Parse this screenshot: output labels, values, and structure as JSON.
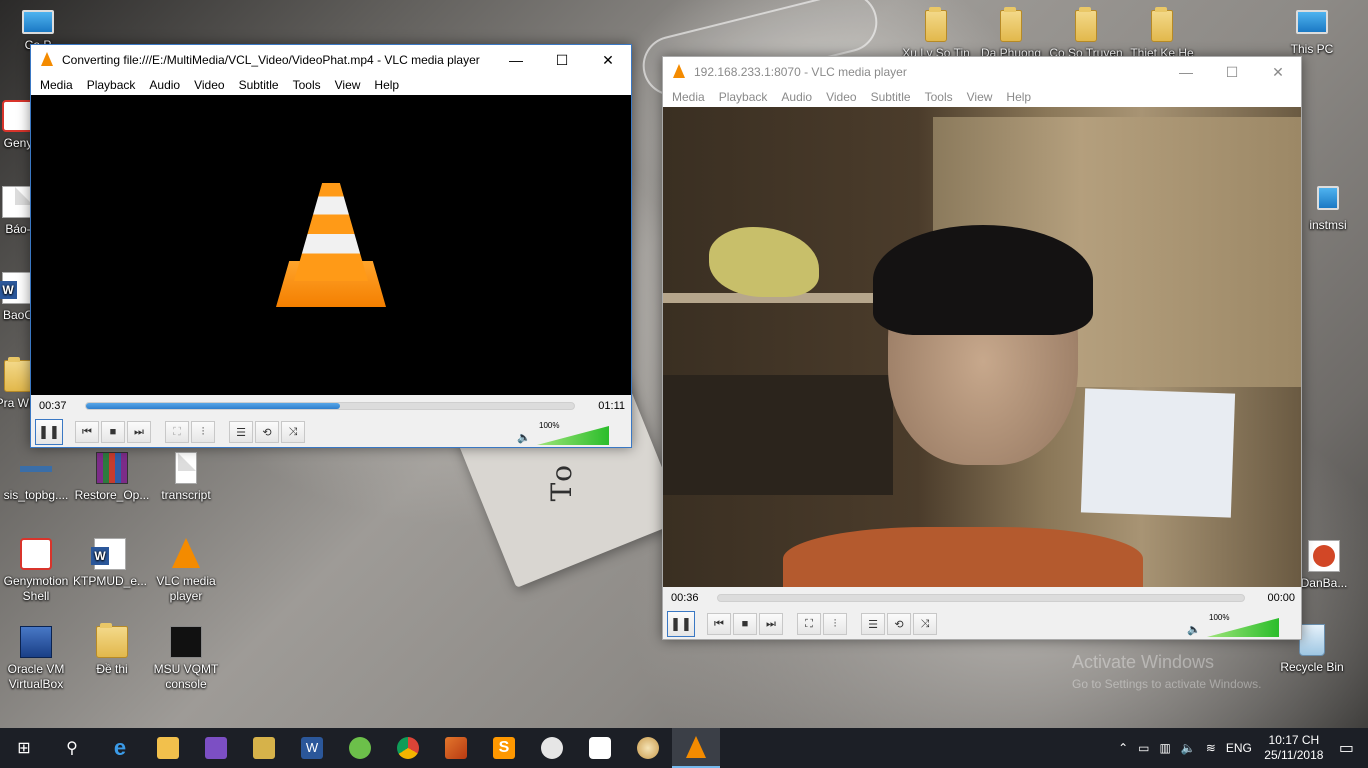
{
  "desktop": {
    "left_icons": [
      {
        "label": "Co P",
        "icon": "control-panel-icon"
      },
      {
        "label": "Geny",
        "icon": "genymotion-icon"
      },
      {
        "label": "Báo-",
        "icon": "doc-icon"
      },
      {
        "label": "BaoC",
        "icon": "word-icon"
      },
      {
        "label": "Pra WPF",
        "icon": "folder-icon"
      },
      {
        "label": "sis_topbg....",
        "icon": "app-icon"
      },
      {
        "label": "Restore_Op...",
        "icon": "winrar-icon"
      },
      {
        "label": "transcript",
        "icon": "doc-icon"
      },
      {
        "label": "Genymotion Shell",
        "icon": "genymotion-icon"
      },
      {
        "label": "KTPMUD_e...",
        "icon": "word-icon"
      },
      {
        "label": "VLC media player",
        "icon": "vlc-icon"
      },
      {
        "label": "Oracle VM VirtualBox",
        "icon": "virtualbox-icon"
      },
      {
        "label": "Đề thi",
        "icon": "folder-icon"
      },
      {
        "label": "MSU VQMT console",
        "icon": "msu-icon"
      }
    ],
    "top_right_icons": [
      {
        "label": "Xu Ly So Tin",
        "icon": "folder-icon"
      },
      {
        "label": "Da Phuong",
        "icon": "folder-icon"
      },
      {
        "label": "Co So Truyen",
        "icon": "folder-icon"
      },
      {
        "label": "Thiet Ke He",
        "icon": "folder-icon"
      },
      {
        "label": "This PC",
        "icon": "computer-icon"
      }
    ],
    "right_icons": [
      {
        "label": "instmsi",
        "icon": "installer-icon"
      },
      {
        "label": "DanBa...",
        "icon": "powerpoint-icon"
      },
      {
        "label": "Recycle Bin",
        "icon": "recycle-bin-icon"
      }
    ],
    "wallpaper_text": "To",
    "activation_watermark": {
      "line1": "Activate Windows",
      "line2": "Go to Settings to activate Windows."
    }
  },
  "vlc_left": {
    "title": "Converting file:///E:/MultiMedia/VCL_Video/VideoPhat.mp4 - VLC media player",
    "menu": [
      "Media",
      "Playback",
      "Audio",
      "Video",
      "Subtitle",
      "Tools",
      "View",
      "Help"
    ],
    "time_elapsed": "00:37",
    "time_total": "01:11",
    "progress_fraction": 0.52,
    "volume_label": "100%",
    "volume_fraction": 1.0
  },
  "vlc_right": {
    "title": "192.168.233.1:8070 - VLC media player",
    "menu": [
      "Media",
      "Playback",
      "Audio",
      "Video",
      "Subtitle",
      "Tools",
      "View",
      "Help"
    ],
    "time_elapsed": "00:36",
    "time_total": "00:00",
    "progress_fraction": 0.0,
    "volume_label": "100%",
    "volume_fraction": 1.0
  },
  "window_controls": {
    "minimize": "—",
    "maximize": "☐",
    "close": "✕"
  },
  "player_controls": {
    "pause": "❚❚",
    "prev": "⏮",
    "stop": "■",
    "next": "⏭",
    "fullscreen": "⛶",
    "extended": "⫶",
    "playlist": "☰",
    "loop": "⟲",
    "shuffle": "⤨",
    "speaker": "🔈"
  },
  "taskbar": {
    "items": [
      {
        "name": "start-button",
        "glyph": "⊞"
      },
      {
        "name": "search-button",
        "glyph": "⚲"
      },
      {
        "name": "edge",
        "glyph": "e"
      },
      {
        "name": "file-explorer",
        "glyph": ""
      },
      {
        "name": "visual-studio",
        "glyph": ""
      },
      {
        "name": "tools-app",
        "glyph": ""
      },
      {
        "name": "word",
        "glyph": "W"
      },
      {
        "name": "green-app",
        "glyph": ""
      },
      {
        "name": "chrome",
        "glyph": ""
      },
      {
        "name": "matlab",
        "glyph": ""
      },
      {
        "name": "sublime",
        "glyph": "S"
      },
      {
        "name": "paint-app",
        "glyph": ""
      },
      {
        "name": "camera-app",
        "glyph": ""
      },
      {
        "name": "paint-palette",
        "glyph": ""
      },
      {
        "name": "vlc",
        "glyph": ""
      }
    ],
    "tray": {
      "language": "ENG",
      "time": "10:17 CH",
      "date": "25/11/2018"
    }
  },
  "colors": {
    "vlc_orange": "#f48b00",
    "taskbar_bg": "#1c1f26",
    "seek_blue": "#2f7fcd",
    "volume_green": "#2bbd2b"
  }
}
